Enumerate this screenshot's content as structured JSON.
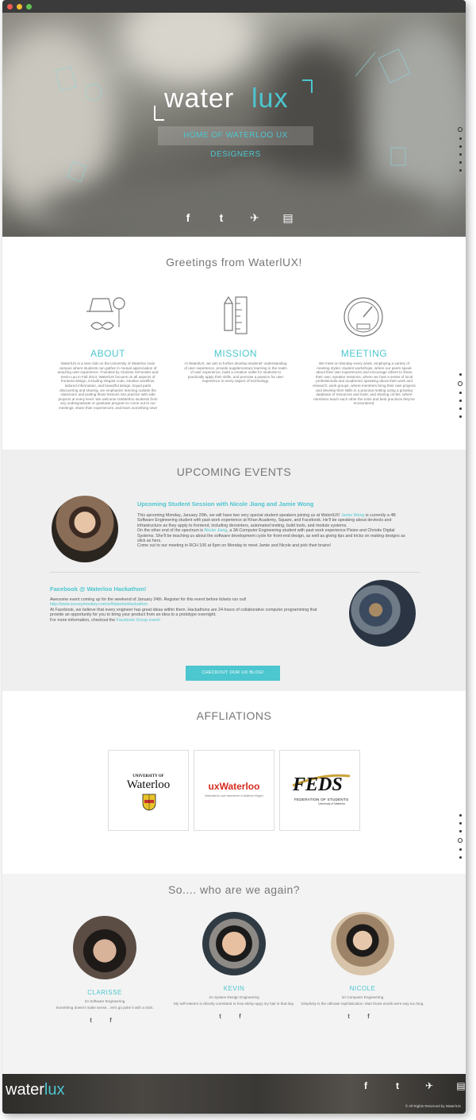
{
  "hero": {
    "logo_main": "water",
    "logo_accent": "lux",
    "tagline": "HOME OF WATERLOO UX DESIGNERS",
    "social": [
      "f",
      "t",
      "✈",
      "▤"
    ]
  },
  "intro": {
    "title": "Greetings from WaterlUX!",
    "columns": [
      {
        "heading": "ABOUT",
        "text": "WaterlUX is a new club on the University of Waterloo main campus where students can gather in mutual appreciation of amazing user experience. Founded by Clarisse Schneider and Kevin Lau in Fall 2013, WaterlUX focuses on all aspects of frontend design, including elegant code, intuitive workflow, tailored information, and beautiful design. Equal parts discovering and sharing, we emphasize learning outside the classroom and putting those lessons into practice with side projects at every level. We welcome UWaterloo students from any undergraduate or graduate program to come out to our meetings, share their experiences, and learn something new!"
      },
      {
        "heading": "MISSION",
        "text": "At WaterlUX, we aim to further develop students' understanding of user experience, provide supplementary learning in the realm of user experience, build a creative outlet for students to practically apply their skills, and promote a passion for user experience in every aspect of technology."
      },
      {
        "heading": "MEETING",
        "text": "We meet on Monday every week, employing a variety of meeting styles: student workshops, where our peers speak about their own experiences and encourage others to share their own; speaker sessions, where we host a series of local professionals and academics speaking about their work and research; work groups, where members bring their own projects and develop their skills in a practical setting using a growing database of resources and tools; and sharing circles, where members teach each other the tools and best practices they've encountered."
      }
    ]
  },
  "events": {
    "title": "UPCOMING EVENTS",
    "items": [
      {
        "title": "Upcoming Student Session with Nicole Jiang and Jamie Wong",
        "p1_a": "This upcoming Monday, January 20th, we will have two very special student speakers joining us at WaterlUX! ",
        "p1_link": "Jamie Wong",
        "p1_b": " is currently a 4B Software Engineering student with past work experience at Khan Academy, Square, and Facebook. He'll be speaking about devtools and infrastructure as they apply to frontend, including devsinters, automated testing, build tools, and module systems.",
        "p2_a": "On the other end of the spectrum is ",
        "p2_link": "Nicole Jiang",
        "p2_b": ", a 3A Computer Engineering student with past work experience Pixiee and Christie Digital Systems. She'll be teaching us about the software development cycle for front-end design, as well as giving tips and tricks on making designs as slick as hers.",
        "p3": "Come out to our meeting in RCH 106 at 6pm on Monday to meet Jamie and Nicole and pick their brains!"
      },
      {
        "title": "Facebook @ Waterloo Hackathon!",
        "p1": "Awesome event coming up for the weekend of January 24th. Register for this event before tickets run out!",
        "link": "http://www.surveymonkey.com/s/WaterlooHackathon",
        "p2": "At Facebook, we believe that every engineer has great ideas within them. Hackathons are 24-hours of collaborative computer programming that provide an opportunity for you to bring your product from an idea to a prototype overnight.",
        "p3_a": "For more information, checkout the ",
        "p3_link": "Facebook Group event!"
      }
    ],
    "button": "CHECKOUT OUR UX BLOG!"
  },
  "affiliations": {
    "title": "AFFLIATIONS",
    "uw_small": "UNIVERSITY OF",
    "uw_big": "Waterloo",
    "uxw_ux": "ux",
    "uxw_rest": "Waterloo",
    "uxw_sub": "Dedicated to user experience in Waterloo Region",
    "feds_big": "FEDS",
    "feds_sub": "FEDERATION OF STUDENTS",
    "feds_sub2": "University of Waterloo"
  },
  "team": {
    "title": "So.... who are we again?",
    "members": [
      {
        "name": "CLARISSE",
        "role": "2A Software Engineering",
        "quote": "Something doesn't make sense... let's go poke it with a stick."
      },
      {
        "name": "KEVIN",
        "role": "2A System Design Engineering",
        "quote": "My self-esteem is directly correlated to how sticky-uppy my hair is that day."
      },
      {
        "name": "NICOLE",
        "role": "3A Computer Engineering",
        "quote": "Simplicity is the ultimate sophistication. Man those words were way too long."
      }
    ],
    "member_social": "t f"
  },
  "footer": {
    "logo_main": "water",
    "logo_accent": "lux",
    "copyright": "© All Rights Reserved by WaterlUX",
    "social": [
      "f",
      "t",
      "✈",
      "▤"
    ]
  },
  "colors": {
    "accent": "#4cc6cf",
    "titlebar": "#3b3b3b",
    "band": "#efefef"
  }
}
